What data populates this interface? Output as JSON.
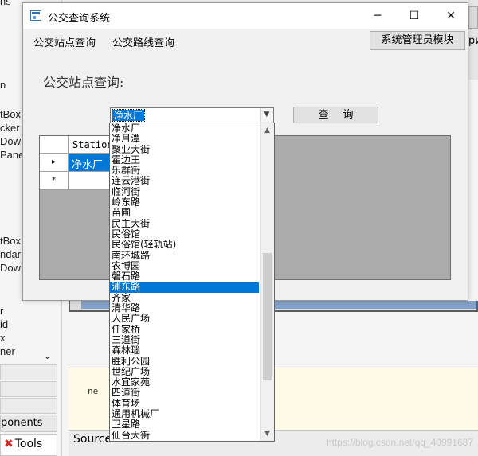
{
  "window": {
    "title": "公交查询系统",
    "minimize_glyph": "─",
    "maximize_glyph": "☐",
    "close_glyph": "✕"
  },
  "menu": {
    "station_query": "公交站点查询",
    "route_query": "公交路线查询",
    "admin_module": "系统管理员模块"
  },
  "form": {
    "heading": "公交站点查询:",
    "combo_selected": "净水厂",
    "query_button": "查询"
  },
  "grid": {
    "column_header": "Station",
    "rows": [
      {
        "marker": "▸",
        "value": "净水厂",
        "selected": true
      },
      {
        "marker": "*",
        "value": "",
        "selected": false
      }
    ]
  },
  "dropdown": {
    "highlighted_index": 15,
    "items": [
      "净水厂",
      "净月潭",
      "聚业大街",
      "霍边王",
      "乐群街",
      "连云港街",
      "临河街",
      "岭东路",
      "苗圃",
      "民主大街",
      "民俗馆",
      "民俗馆(轻轨站)",
      "南环城路",
      "农博园",
      "磐石路",
      "浦东路",
      "齐家",
      "清华路",
      "人民广场",
      "任家桥",
      "三道街",
      "森林瑙",
      "胜利公园",
      "世纪广场",
      "水宜家苑",
      "四道街",
      "体育场",
      "通用机械厂",
      "卫星路",
      "仙台大街"
    ]
  },
  "ide": {
    "left_fragments": [
      "ns",
      "n",
      "tBox",
      "cker",
      "Dow",
      "Pane",
      "tBox",
      "ndar",
      "Dow",
      "r",
      "id",
      "x",
      "ner"
    ],
    "components_tab": "ponents",
    "tools_tab": "Tools",
    "source_tab": "Source",
    "code_snippet": "ne",
    "watermark": "https://blog.csdn.net/qq_40991687",
    "right_fragment": "ри"
  },
  "colors": {
    "selection": "#0078d7",
    "grid_bg": "#ababab",
    "window_bg": "#f0f0f0"
  }
}
